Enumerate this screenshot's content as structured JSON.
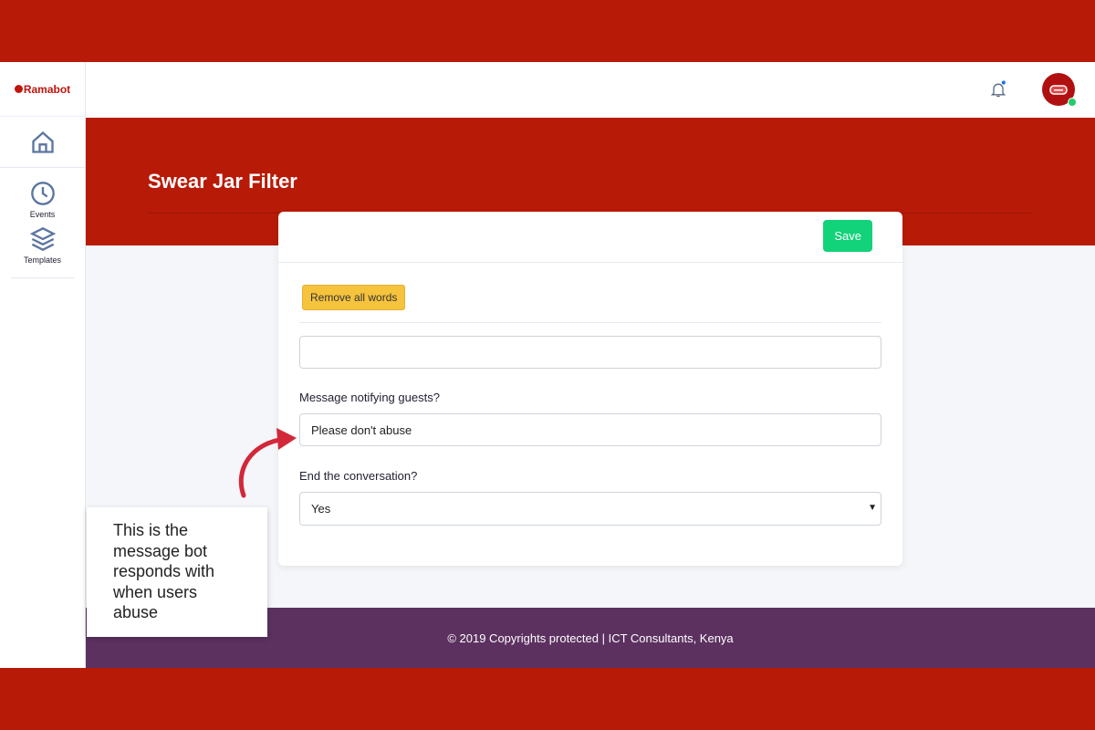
{
  "brand": "Ramabot",
  "sidebar": {
    "items": [
      {
        "label": "Events"
      },
      {
        "label": "Templates"
      }
    ]
  },
  "page": {
    "title": "Swear Jar Filter"
  },
  "form": {
    "save_label": "Save",
    "remove_label": "Remove all words",
    "word_value": "",
    "message_label": "Message notifying guests?",
    "message_value": "Please don't abuse",
    "end_label": "End the conversation?",
    "end_value": "Yes"
  },
  "footer": {
    "text": "© 2019 Copyrights protected | ICT Consultants, Kenya"
  },
  "annotation": {
    "text": "This is the message bot responds with when users abuse"
  }
}
